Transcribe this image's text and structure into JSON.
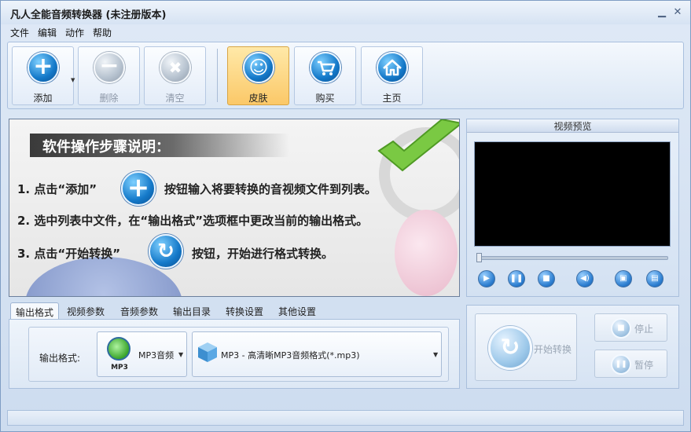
{
  "window": {
    "title": "凡人全能音频转换器  (未注册版本)"
  },
  "menu": [
    "文件",
    "编辑",
    "动作",
    "帮助"
  ],
  "toolbar": {
    "add": "添加",
    "delete": "删除",
    "clear": "清空",
    "skin": "皮肤",
    "buy": "购买",
    "home": "主页"
  },
  "guide": {
    "title": "软件操作步骤说明：",
    "step1_a": "1. 点击“添加”",
    "step1_b": "按钮输入将要转换的音视频文件到列表。",
    "step2": "2. 选中列表中文件，在“输出格式”选项框中更改当前的输出格式。",
    "step3_a": "3. 点击“开始转换”",
    "step3_b": "按钮，开始进行格式转换。"
  },
  "preview": {
    "title": "视频预览"
  },
  "tabs": [
    "输出格式",
    "视频参数",
    "音频参数",
    "输出目录",
    "转换设置",
    "其他设置"
  ],
  "output": {
    "label": "输出格式:",
    "category": "MP3音频",
    "category_icon_text": "MP3",
    "format": "MP3 - 高清晰MP3音频格式(*.mp3)"
  },
  "actions": {
    "start": "开始转换",
    "stop": "停止",
    "pause": "暂停"
  },
  "colors": {
    "accent": "#1479c9",
    "active_button": "#fbc868"
  }
}
